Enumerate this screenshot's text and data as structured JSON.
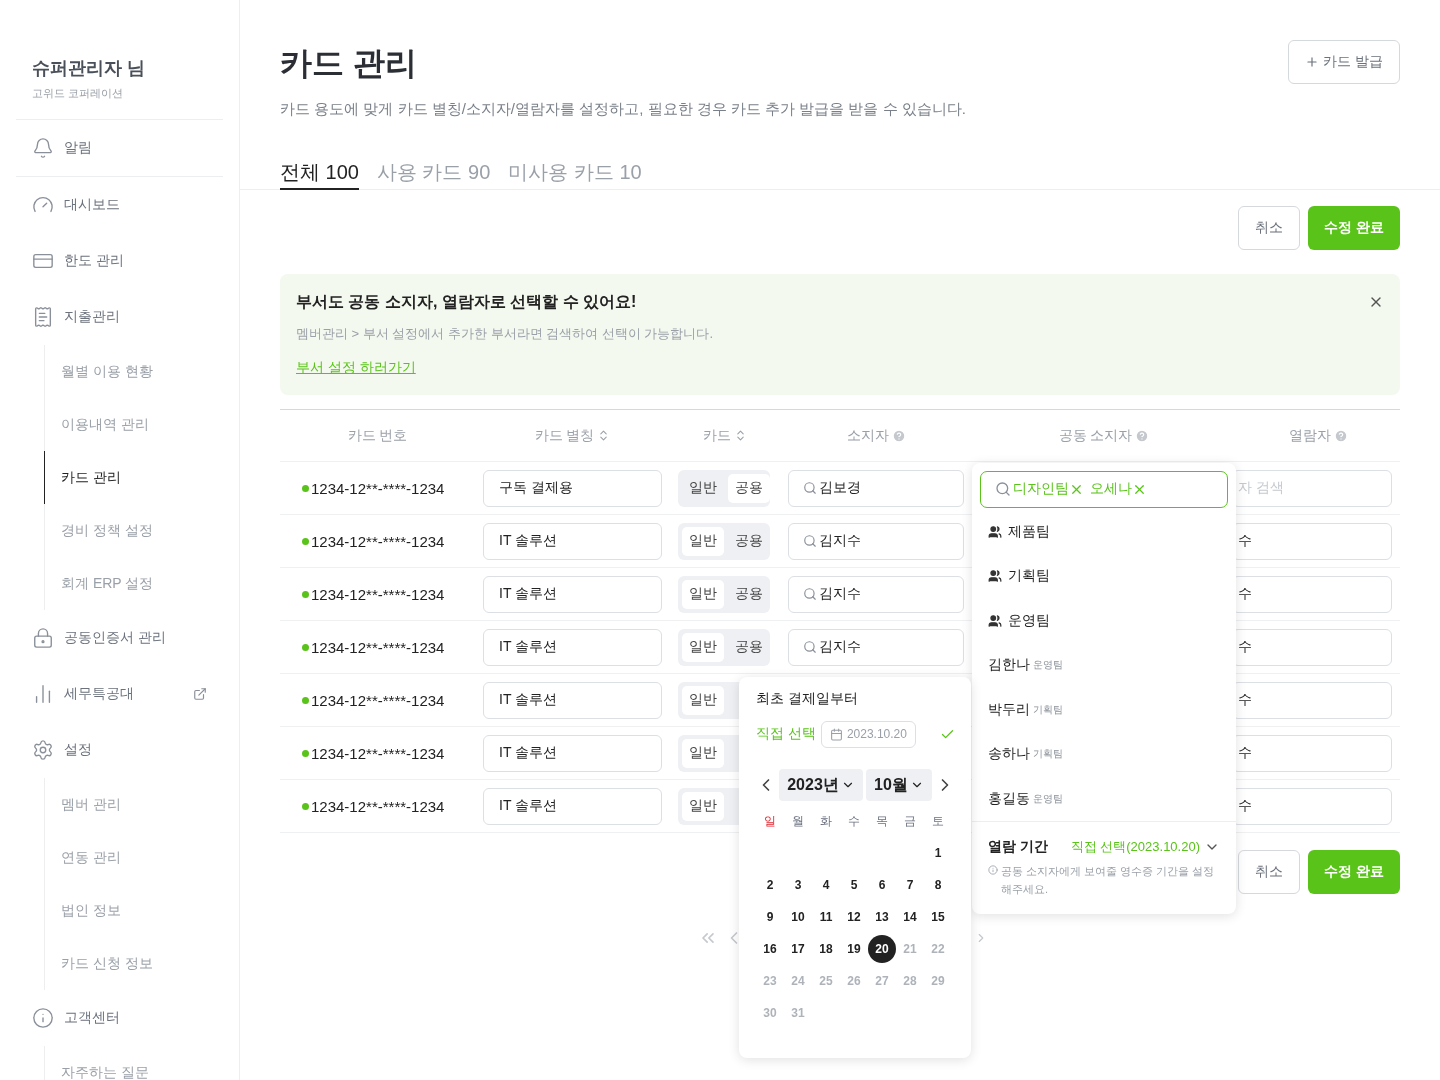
{
  "sidebar": {
    "user": "슈퍼관리자 님",
    "company": "고위드 코퍼레이션",
    "items": [
      {
        "label": "알림",
        "selected": false,
        "external": false
      },
      {
        "label": "대시보드",
        "selected": false,
        "external": false
      },
      {
        "label": "한도 관리",
        "selected": false,
        "external": false
      },
      {
        "label": "지출관리",
        "selected": false,
        "external": false,
        "children": [
          {
            "label": "월별 이용 현황",
            "selected": false
          },
          {
            "label": "이용내역 관리",
            "selected": false
          },
          {
            "label": "카드 관리",
            "selected": true
          },
          {
            "label": "경비 정책 설정",
            "selected": false
          },
          {
            "label": "회계 ERP 설정",
            "selected": false
          }
        ]
      },
      {
        "label": "공동인증서 관리",
        "selected": false,
        "external": false
      },
      {
        "label": "세무특공대",
        "selected": false,
        "external": true
      },
      {
        "label": "설정",
        "selected": false,
        "external": false,
        "children": [
          {
            "label": "멤버 관리",
            "selected": false
          },
          {
            "label": "연동 관리",
            "selected": false
          },
          {
            "label": "법인 정보",
            "selected": false
          },
          {
            "label": "카드 신청 정보",
            "selected": false
          }
        ]
      },
      {
        "label": "고객센터",
        "selected": false,
        "external": false,
        "children": [
          {
            "label": "자주하는 질문",
            "selected": false
          }
        ]
      }
    ]
  },
  "page": {
    "title": "카드 관리",
    "subtitle": "카드 용도에 맞게 카드 별칭/소지자/열람자를 설정하고, 필요한 경우 카드 추가 발급을 받을 수 있습니다.",
    "issue_button": "카드 발급"
  },
  "tabs": [
    {
      "label": "전체 100",
      "selected": true
    },
    {
      "label": "사용 카드 90",
      "selected": false
    },
    {
      "label": "미사용 카드 10",
      "selected": false
    }
  ],
  "actions": {
    "cancel": "취소",
    "save": "수정 완료"
  },
  "bottom_actions": {
    "cancel": "취소",
    "save": "수정 완료"
  },
  "banner": {
    "title": "부서도 공동 소지자, 열람자로 선택할 수 있어요!",
    "text": "멤버관리 > 부서 설정에서 추가한 부서라면 검색하여 선택이 가능합니다.",
    "link": "부서 설정 하러가기"
  },
  "table": {
    "columns": [
      {
        "label": "카드 번호",
        "kind": "plain"
      },
      {
        "label": "카드 별칭",
        "kind": "sort"
      },
      {
        "label": "카드",
        "kind": "sort"
      },
      {
        "label": "소지자",
        "kind": "help"
      },
      {
        "label": "공동 소지자",
        "kind": "help"
      },
      {
        "label": "열람자",
        "kind": "help"
      }
    ],
    "rows": [
      {
        "number": "1234-12**-****-1234",
        "active": true,
        "alias": "구독 결제용",
        "types": [
          {
            "label": "일반",
            "selected": false
          },
          {
            "label": "공용",
            "selected": true
          }
        ],
        "owner": "김보경",
        "viewer": {
          "placeholder": "자 검색"
        }
      },
      {
        "number": "1234-12**-****-1234",
        "active": true,
        "alias": "IT 솔루션",
        "types": [
          {
            "label": "일반",
            "selected": true
          },
          {
            "label": "공용",
            "selected": false
          }
        ],
        "owner": "김지수",
        "viewer": {
          "value": "수"
        }
      },
      {
        "number": "1234-12**-****-1234",
        "active": true,
        "alias": "IT 솔루션",
        "types": [
          {
            "label": "일반",
            "selected": true
          },
          {
            "label": "공용",
            "selected": false
          }
        ],
        "owner": "김지수",
        "viewer": {
          "value": "수"
        }
      },
      {
        "number": "1234-12**-****-1234",
        "active": true,
        "alias": "IT 솔루션",
        "types": [
          {
            "label": "일반",
            "selected": true
          },
          {
            "label": "공용",
            "selected": false
          }
        ],
        "owner": "김지수",
        "viewer": {
          "value": "수"
        }
      },
      {
        "number": "1234-12**-****-1234",
        "active": true,
        "alias": "IT 솔루션",
        "types": [
          {
            "label": "일반",
            "selected": true
          }
        ],
        "viewer": {
          "value": "수"
        }
      },
      {
        "number": "1234-12**-****-1234",
        "active": true,
        "alias": "IT 솔루션",
        "types": [
          {
            "label": "일반",
            "selected": true
          }
        ],
        "viewer": {
          "value": "수"
        }
      },
      {
        "number": "1234-12**-****-1234",
        "active": true,
        "alias": "IT 솔루션",
        "types": [
          {
            "label": "일반",
            "selected": true
          }
        ],
        "viewer": {
          "value": "수"
        }
      }
    ]
  },
  "co_owner_dropdown": {
    "tokens": [
      "디자인팀",
      "오세나"
    ],
    "options": [
      {
        "kind": "team",
        "label": "제품팀"
      },
      {
        "kind": "team",
        "label": "기획팀"
      },
      {
        "kind": "team",
        "label": "운영팀"
      },
      {
        "kind": "member",
        "label": "김한나",
        "team": "운영팀"
      },
      {
        "kind": "member",
        "label": "박두리",
        "team": "기획팀"
      },
      {
        "kind": "member",
        "label": "송하나",
        "team": "기획팀"
      },
      {
        "kind": "member",
        "label": "홍길동",
        "team": "운영팀"
      }
    ],
    "period_label": "열람 기간",
    "period_value": "직접 선택(2023.10.20)",
    "note": "공동 소지자에게 보여줄 영수증 기간을 설정해주세요."
  },
  "date_popover": {
    "options": [
      {
        "label": "최초 결제일부터",
        "selected": false
      },
      {
        "label": "직접 선택",
        "selected": true,
        "date": "2023.10.20"
      }
    ],
    "year": "2023년",
    "month": "10월",
    "weekdays": [
      {
        "label": "일",
        "holiday": true
      },
      {
        "label": "월",
        "holiday": false
      },
      {
        "label": "화",
        "holiday": false
      },
      {
        "label": "수",
        "holiday": false
      },
      {
        "label": "목",
        "holiday": false
      },
      {
        "label": "금",
        "holiday": false
      },
      {
        "label": "토",
        "holiday": false
      }
    ],
    "weeks": [
      [
        {
          "kind": "blank"
        },
        {
          "kind": "blank"
        },
        {
          "kind": "blank"
        },
        {
          "kind": "blank"
        },
        {
          "kind": "blank"
        },
        {
          "kind": "blank"
        },
        {
          "kind": "day",
          "label": "1",
          "selected": false,
          "disabled": false
        }
      ],
      [
        {
          "label": "2",
          "selected": false,
          "disabled": false
        },
        {
          "label": "3",
          "selected": false,
          "disabled": false
        },
        {
          "label": "4",
          "selected": false,
          "disabled": false
        },
        {
          "label": "5",
          "selected": false,
          "disabled": false
        },
        {
          "label": "6",
          "selected": false,
          "disabled": false
        },
        {
          "label": "7",
          "selected": false,
          "disabled": false
        },
        {
          "label": "8",
          "selected": false,
          "disabled": false
        }
      ],
      [
        {
          "label": "9",
          "selected": false,
          "disabled": false
        },
        {
          "label": "10",
          "selected": false,
          "disabled": false
        },
        {
          "label": "11",
          "selected": false,
          "disabled": false
        },
        {
          "label": "12",
          "selected": false,
          "disabled": false
        },
        {
          "label": "13",
          "selected": false,
          "disabled": false
        },
        {
          "label": "14",
          "selected": false,
          "disabled": false
        },
        {
          "label": "15",
          "selected": false,
          "disabled": false
        }
      ],
      [
        {
          "label": "16",
          "selected": false,
          "disabled": false
        },
        {
          "label": "17",
          "selected": false,
          "disabled": false
        },
        {
          "label": "18",
          "selected": false,
          "disabled": false
        },
        {
          "label": "19",
          "selected": false,
          "disabled": false
        },
        {
          "label": "20",
          "selected": true,
          "disabled": false
        },
        {
          "label": "21",
          "selected": false,
          "disabled": true
        },
        {
          "label": "22",
          "selected": false,
          "disabled": true
        }
      ],
      [
        {
          "label": "23",
          "selected": false,
          "disabled": true
        },
        {
          "label": "24",
          "selected": false,
          "disabled": true
        },
        {
          "label": "25",
          "selected": false,
          "disabled": true
        },
        {
          "label": "26",
          "selected": false,
          "disabled": true
        },
        {
          "label": "27",
          "selected": false,
          "disabled": true
        },
        {
          "label": "28",
          "selected": false,
          "disabled": true
        },
        {
          "label": "29",
          "selected": false,
          "disabled": true
        }
      ],
      [
        {
          "label": "30",
          "selected": false,
          "disabled": true
        },
        {
          "label": "31",
          "selected": false,
          "disabled": true
        }
      ]
    ]
  }
}
